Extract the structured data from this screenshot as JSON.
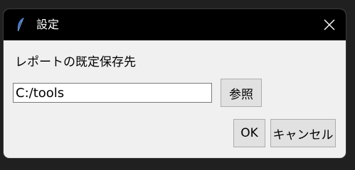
{
  "window": {
    "title": "設定",
    "app_icon": "feather-icon",
    "close_icon": "close-icon"
  },
  "form": {
    "label": "レポートの既定保存先",
    "path_value": "C:/tools",
    "browse_label": "参照"
  },
  "actions": {
    "ok_label": "OK",
    "cancel_label": "キャンセル"
  },
  "colors": {
    "titlebar_bg": "#000000",
    "window_bg": "#f0f0f0",
    "button_bg": "#e1e1e1",
    "accent_icon": "#4a7fd1"
  }
}
